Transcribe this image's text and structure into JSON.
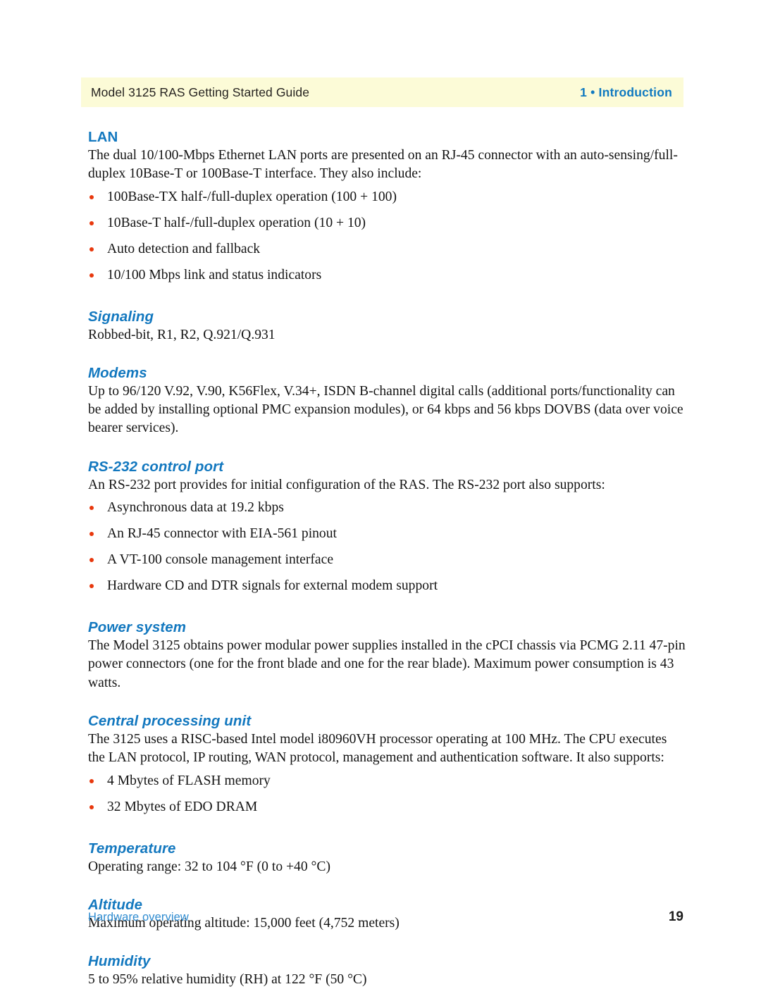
{
  "header": {
    "left_title": "Model 3125 RAS Getting Started Guide",
    "right_title": "1 • Introduction",
    "band_color": "#fcfbd7",
    "accent_color": "#0f79c0"
  },
  "footer": {
    "left_text": "Hardware overview",
    "page_number": "19"
  },
  "theme": {
    "heading_color": "#1378bf",
    "bullet_color": "#e8380d",
    "body_color": "#141414"
  },
  "sections": [
    {
      "id": "lan",
      "heading": "LAN",
      "heading_style": "plain",
      "paragraph": "The dual 10/100-Mbps Ethernet LAN ports are presented on an RJ-45 connector with an auto-sensing/full-duplex 10Base-T or 100Base-T interface. They also include:",
      "bullets": [
        "100Base-TX half-/full-duplex operation (100 + 100)",
        "10Base-T half-/full-duplex operation (10 + 10)",
        "Auto detection and fallback",
        "10/100 Mbps link and status indicators"
      ]
    },
    {
      "id": "signaling",
      "heading": "Signaling",
      "heading_style": "italic",
      "paragraph": "Robbed-bit, R1, R2, Q.921/Q.931",
      "bullets": []
    },
    {
      "id": "modems",
      "heading": "Modems",
      "heading_style": "italic",
      "paragraph": "Up to 96/120 V.92, V.90, K56Flex, V.34+, ISDN B-channel digital calls (additional ports/functionality can be added by installing optional PMC expansion modules), or 64 kbps and 56 kbps DOVBS (data over voice bearer services).",
      "bullets": []
    },
    {
      "id": "rs232-control-port",
      "heading": "RS-232 control port",
      "heading_style": "italic",
      "paragraph": "An RS-232 port provides for initial configuration of the RAS. The RS-232 port also supports:",
      "bullets": [
        "Asynchronous data at 19.2 kbps",
        "An RJ-45 connector with EIA-561 pinout",
        "A VT-100 console management interface",
        "Hardware CD and DTR signals for external modem support"
      ]
    },
    {
      "id": "power-system",
      "heading": "Power system",
      "heading_style": "italic",
      "paragraph": "The Model 3125 obtains power modular power supplies installed in the cPCI chassis via PCMG 2.11 47-pin power connectors (one for the front blade and one for the rear blade). Maximum power consumption is 43 watts.",
      "bullets": []
    },
    {
      "id": "central-processing-unit",
      "heading": "Central processing unit",
      "heading_style": "italic",
      "paragraph": "The 3125 uses a RISC-based Intel model i80960VH processor operating at 100 MHz. The CPU executes the LAN protocol, IP routing, WAN protocol, management and authentication software. It also supports:",
      "bullets": [
        "4 Mbytes of FLASH memory",
        "32 Mbytes of EDO DRAM"
      ]
    },
    {
      "id": "temperature",
      "heading": "Temperature",
      "heading_style": "italic",
      "paragraph": "Operating range: 32 to 104 °F (0  to +40 °C)",
      "bullets": []
    },
    {
      "id": "altitude",
      "heading": "Altitude",
      "heading_style": "italic",
      "paragraph": "Maximum operating altitude: 15,000 feet (4,752 meters)",
      "bullets": []
    },
    {
      "id": "humidity",
      "heading": "Humidity",
      "heading_style": "italic",
      "paragraph": "5 to 95% relative humidity (RH) at 122 °F (50 °C)",
      "bullets": []
    }
  ]
}
